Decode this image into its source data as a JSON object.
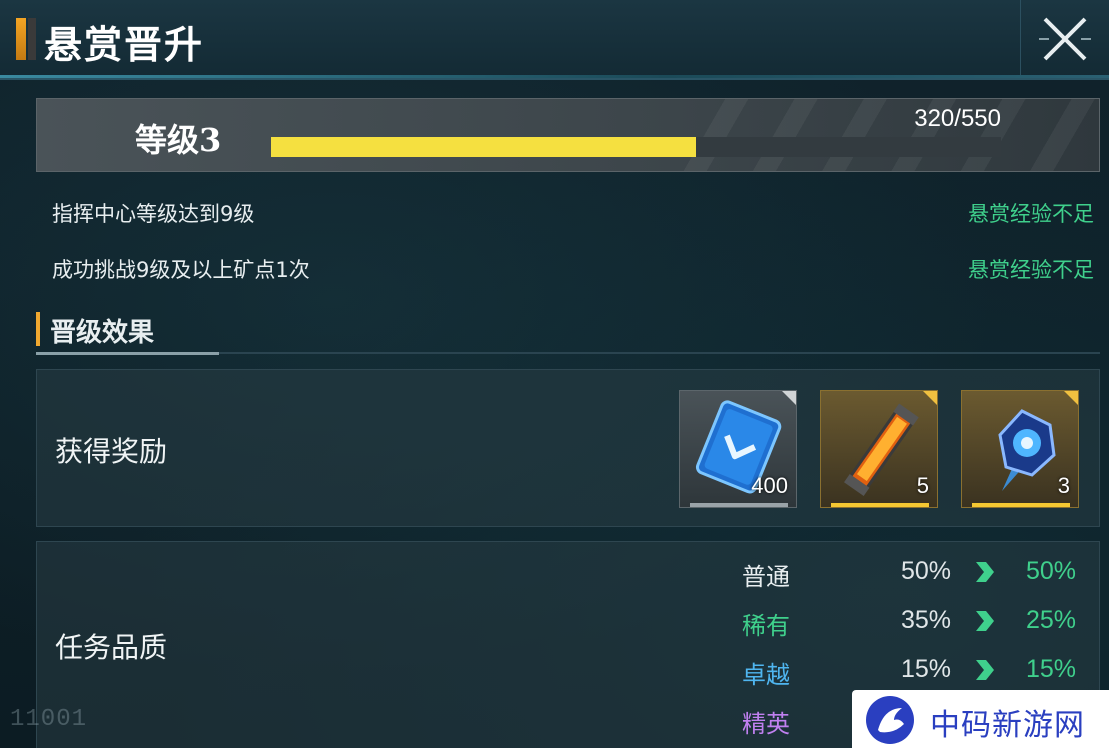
{
  "header": {
    "title": "悬赏晋升",
    "close_icon": "close-x-icon"
  },
  "level": {
    "label": "等级3",
    "current": 320,
    "max": 550,
    "count_text": "320/550",
    "progress": 0.582,
    "bar_color": "#f5e040"
  },
  "requirements": [
    {
      "text": "指挥中心等级达到9级",
      "status": "悬赏经验不足"
    },
    {
      "text": "成功挑战9级及以上矿点1次",
      "status": "悬赏经验不足"
    }
  ],
  "section": {
    "title": "晋级效果"
  },
  "rewards": {
    "label": "获得奖励",
    "items": [
      {
        "icon": "blue-card-icon",
        "count": "400",
        "rarity": "normal"
      },
      {
        "icon": "orange-tube-icon",
        "count": "5",
        "rarity": "gold"
      },
      {
        "icon": "blue-crystal-icon",
        "count": "3",
        "rarity": "gold"
      }
    ]
  },
  "quality": {
    "label": "任务品质",
    "rows": [
      {
        "name": "普通",
        "old": "50%",
        "new": "50%",
        "color": "#e8eef0"
      },
      {
        "name": "稀有",
        "old": "35%",
        "new": "25%",
        "color": "#3fd08c"
      },
      {
        "name": "卓越",
        "old": "15%",
        "new": "15%",
        "color": "#4fb6f0"
      },
      {
        "name": "精英",
        "old": "",
        "new": "",
        "color": "#c080f0"
      }
    ]
  },
  "footer": {
    "id_text": "11001",
    "watermark_text": "中码新游网"
  },
  "colors": {
    "status_green": "#3fd08c",
    "accent_orange": "#f0a830",
    "watermark_blue": "#2a3fc0"
  }
}
